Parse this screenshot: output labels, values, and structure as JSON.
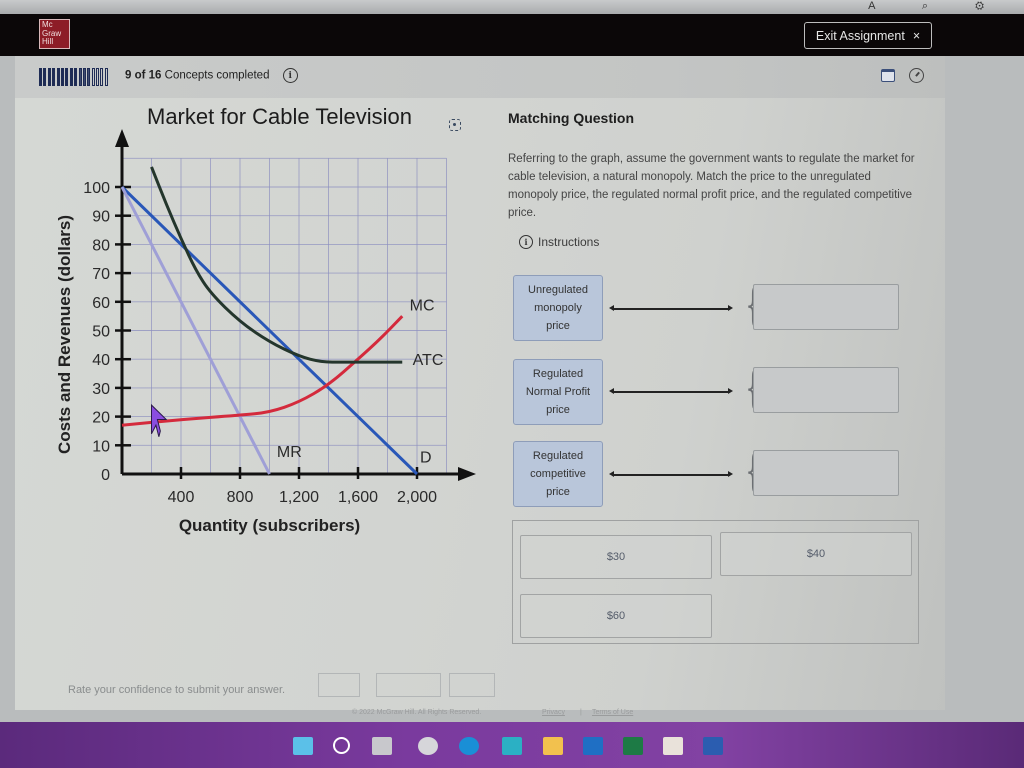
{
  "browser": {
    "icons": [
      "font-icon",
      "search-icon",
      "profile-icon"
    ]
  },
  "header": {
    "logo_lines": [
      "Mc",
      "Graw",
      "Hill"
    ],
    "exit_label": "Exit Assignment",
    "exit_icon": "×"
  },
  "progress": {
    "completed": 9,
    "total": 16,
    "count_label": "9 of 16",
    "label": "Concepts completed",
    "info_icon": "i",
    "right_icons": [
      "calendar-icon",
      "clock-icon"
    ]
  },
  "chart_data": {
    "type": "line",
    "title": "Market for Cable Television",
    "xlabel": "Quantity (subscribers)",
    "ylabel": "Costs and Revenues (dollars)",
    "xlim": [
      0,
      2200
    ],
    "ylim": [
      0,
      110
    ],
    "x_ticks": [
      400,
      800,
      1200,
      1600,
      2000
    ],
    "x_tick_labels": [
      "400",
      "800",
      "1,200",
      "1,600",
      "2,000"
    ],
    "y_ticks": [
      0,
      10,
      20,
      30,
      40,
      50,
      60,
      70,
      80,
      90,
      100
    ],
    "y_tick_labels": [
      "0",
      "10",
      "20",
      "30",
      "40",
      "50",
      "60",
      "70",
      "80",
      "90",
      "100"
    ],
    "grid": true,
    "series": [
      {
        "name": "D",
        "color": "#2957b8",
        "points": [
          [
            0,
            100
          ],
          [
            2000,
            0
          ]
        ]
      },
      {
        "name": "MR",
        "color": "#9f9fd6",
        "points": [
          [
            0,
            100
          ],
          [
            1000,
            0
          ]
        ]
      },
      {
        "name": "MC",
        "color": "#d42a3c",
        "points": [
          [
            0,
            17
          ],
          [
            400,
            19
          ],
          [
            800,
            20.5
          ],
          [
            1000,
            21.5
          ],
          [
            1200,
            25
          ],
          [
            1400,
            31
          ],
          [
            1600,
            40
          ],
          [
            1750,
            47
          ],
          [
            1900,
            55
          ]
        ]
      },
      {
        "name": "ATC",
        "color": "#24362c",
        "points": [
          [
            200,
            107
          ],
          [
            300,
            94
          ],
          [
            400,
            82
          ],
          [
            500,
            71
          ],
          [
            600,
            63
          ],
          [
            800,
            53
          ],
          [
            1000,
            46
          ],
          [
            1200,
            41
          ],
          [
            1350,
            39
          ],
          [
            1500,
            39
          ],
          [
            1900,
            39
          ]
        ]
      }
    ],
    "annotations": [
      "MC",
      "ATC",
      "MR",
      "D"
    ]
  },
  "question": {
    "type_label": "Matching Question",
    "text": "Referring to the graph, assume the government wants to regulate the market for cable television, a natural monopoly. Match the price to the unregulated monopoly price, the regulated normal profit price, and the regulated competitive price.",
    "instructions_label": "Instructions",
    "prompts": [
      {
        "label": "Unregulated monopoly price",
        "answer": ""
      },
      {
        "label": "Regulated Normal Profit price",
        "answer": ""
      },
      {
        "label": "Regulated competitive price",
        "answer": ""
      }
    ],
    "choices": [
      "$30",
      "$40",
      "$60"
    ]
  },
  "footer": {
    "confidence_prompt": "Rate your confidence to submit your answer.",
    "copyright": "© 2022 McGraw Hill. All Rights Reserved.",
    "privacy": "Privacy",
    "terms": "Terms of Use"
  },
  "taskbar": {
    "apps": [
      "start-icon",
      "search-icon",
      "task-view-icon",
      "chat-icon",
      "edge-icon",
      "store-bag-icon",
      "file-explorer-icon",
      "outlook-icon",
      "excel-icon",
      "microsoft-store-icon",
      "word-icon"
    ]
  }
}
